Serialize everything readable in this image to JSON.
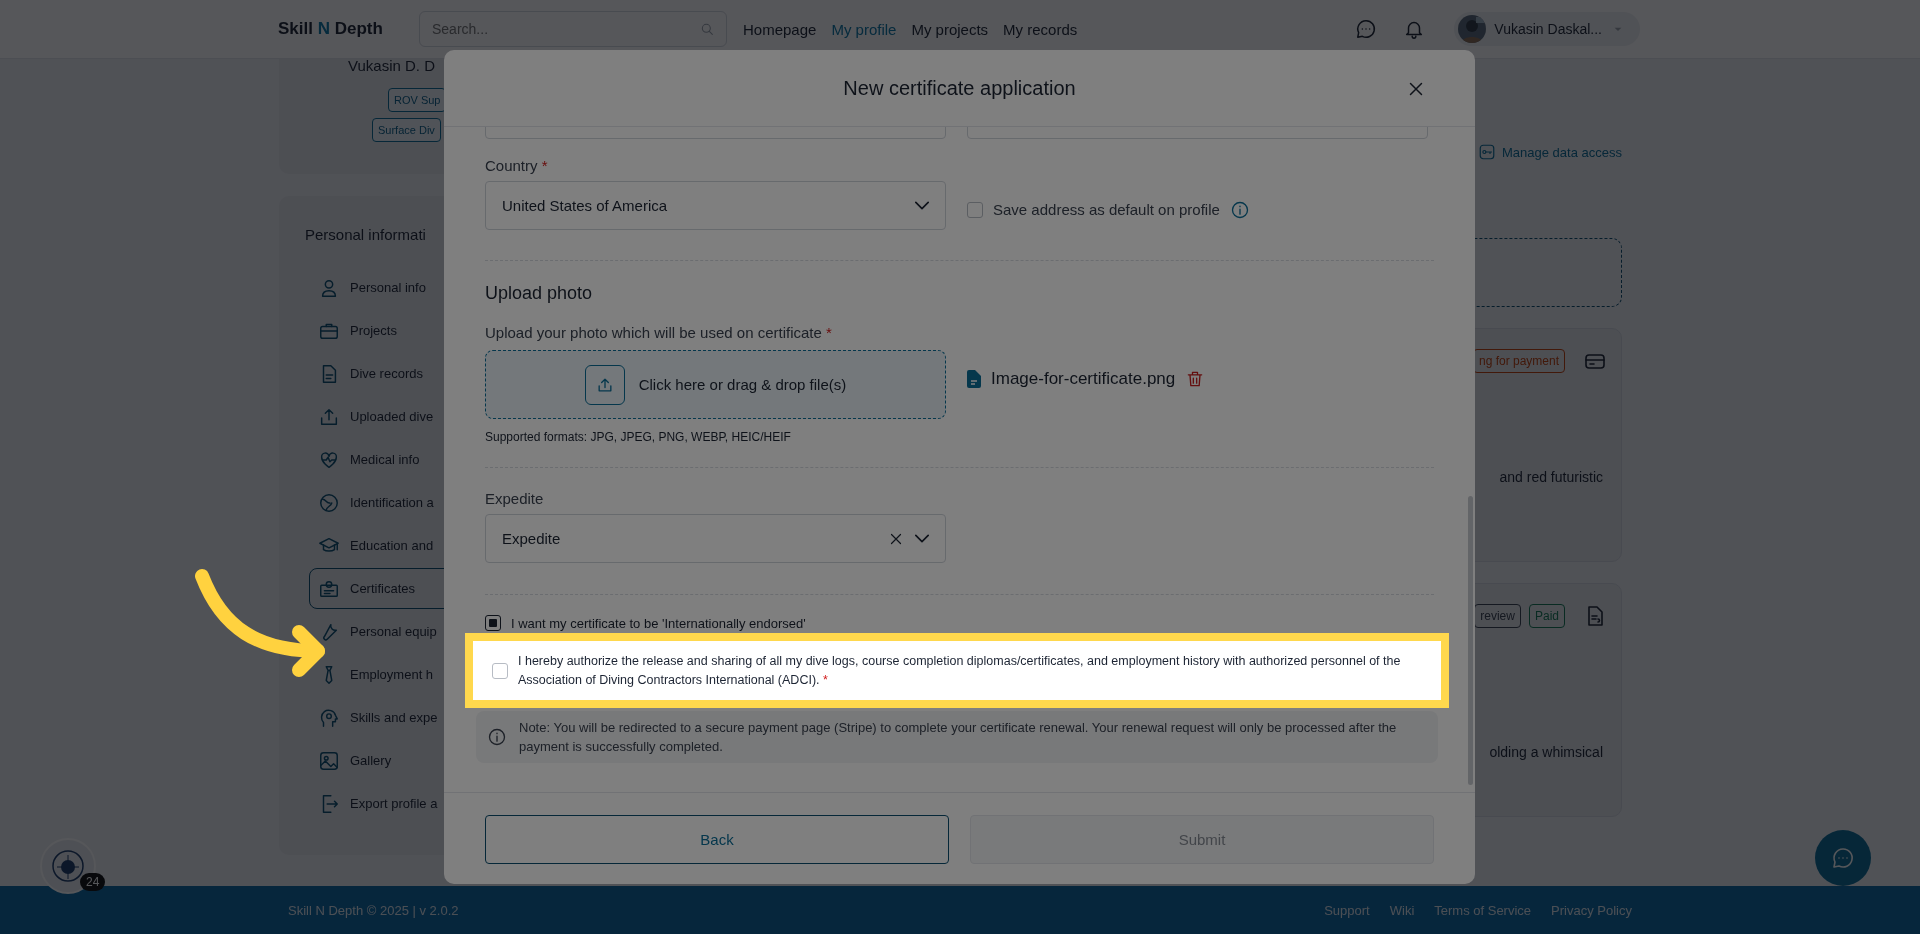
{
  "header": {
    "logo": {
      "before": "Skill",
      "accent": "N",
      "after": "Depth"
    },
    "search": {
      "placeholder": "Search..."
    },
    "nav": [
      {
        "label": "Homepage",
        "selected": false
      },
      {
        "label": "My profile",
        "selected": true
      },
      {
        "label": "My projects",
        "selected": false
      },
      {
        "label": "My records",
        "selected": false
      }
    ],
    "user": {
      "name": "Vukasin Daskal..."
    }
  },
  "profile_card": {
    "name": "Vukasin D. D",
    "tags": [
      "ROV Sup",
      "Surface Div"
    ]
  },
  "sidebar": {
    "title": "Personal informati",
    "items": [
      {
        "label": "Personal info",
        "selected": false
      },
      {
        "label": "Projects",
        "selected": false
      },
      {
        "label": "Dive records",
        "selected": false
      },
      {
        "label": "Uploaded dive",
        "selected": false
      },
      {
        "label": "Medical info",
        "selected": false
      },
      {
        "label": "Identification a",
        "selected": false
      },
      {
        "label": "Education and",
        "selected": false
      },
      {
        "label": "Certificates",
        "selected": true
      },
      {
        "label": "Personal equip",
        "selected": false
      },
      {
        "label": "Employment h",
        "selected": false
      },
      {
        "label": "Skills and expe",
        "selected": false
      },
      {
        "label": "Gallery",
        "selected": false
      },
      {
        "label": "Export profile a",
        "selected": false
      }
    ]
  },
  "right_panel": {
    "manage_link": "Manage data access",
    "cards": [
      {
        "badges": [
          {
            "label": "ng for payment",
            "kind": "warning"
          }
        ],
        "text": "and red futuristic"
      },
      {
        "badges": [
          {
            "label": "review",
            "kind": "neutral"
          },
          {
            "label": "Paid",
            "kind": "success"
          }
        ],
        "text": "olding a whimsical"
      }
    ]
  },
  "modal": {
    "title": "New certificate application",
    "country": {
      "label": "Country",
      "required_mark": "*",
      "value": "United States of America"
    },
    "save_default": {
      "label": "Save address as default on profile",
      "checked": false
    },
    "upload": {
      "heading": "Upload photo",
      "label": "Upload your photo which will be used on certificate",
      "required_mark": "*",
      "dropzone": "Click here or drag & drop file(s)",
      "formats": "Supported formats: JPG, JPEG, PNG, WEBP, HEIC/HEIF",
      "file": "Image-for-certificate.png"
    },
    "expedite": {
      "label": "Expedite",
      "value": "Expedite"
    },
    "endorsed": {
      "label": "I want my certificate to be 'Internationally endorsed'",
      "checked": true
    },
    "consent": {
      "label": "I hereby authorize the release and sharing of all my dive logs, course completion diplomas/certificates, and employment history with authorized personnel of the Association of Diving Contractors International (ADCI).",
      "required_mark": "*",
      "checked": false
    },
    "note": "Note: You will be redirected to a secure payment page (Stripe) to complete your certificate renewal. Your renewal request will only be processed after the payment is successfully completed.",
    "buttons": [
      {
        "label": "Back",
        "disabled": false
      },
      {
        "label": "Submit",
        "disabled": true
      }
    ]
  },
  "footer": {
    "copyright": "Skill N Depth © 2025 | v 2.0.2",
    "links": [
      "Support",
      "Wiki",
      "Terms of Service",
      "Privacy Policy"
    ]
  },
  "chat_badge": "24"
}
